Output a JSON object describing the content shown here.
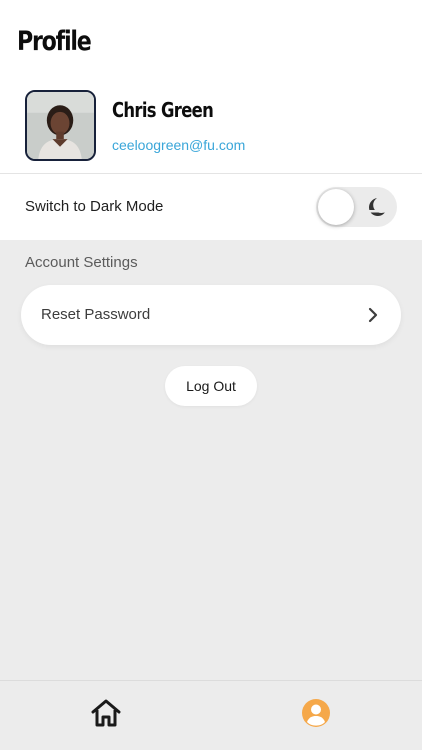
{
  "header": {
    "title": "Profile"
  },
  "user": {
    "name": "Chris Green",
    "email": "ceeloogreen@fu.com"
  },
  "settings": {
    "dark_mode_label": "Switch to Dark Mode",
    "dark_mode_enabled": false,
    "section_title": "Account Settings",
    "reset_password_label": "Reset Password"
  },
  "actions": {
    "logout_label": "Log Out"
  },
  "tabbar": {
    "tabs": [
      {
        "icon": "home-icon",
        "active": false
      },
      {
        "icon": "profile-icon",
        "active": true
      }
    ]
  },
  "colors": {
    "accent_email": "#3aa6d9",
    "active_tab": "#f5a84a",
    "background": "#ececec"
  }
}
